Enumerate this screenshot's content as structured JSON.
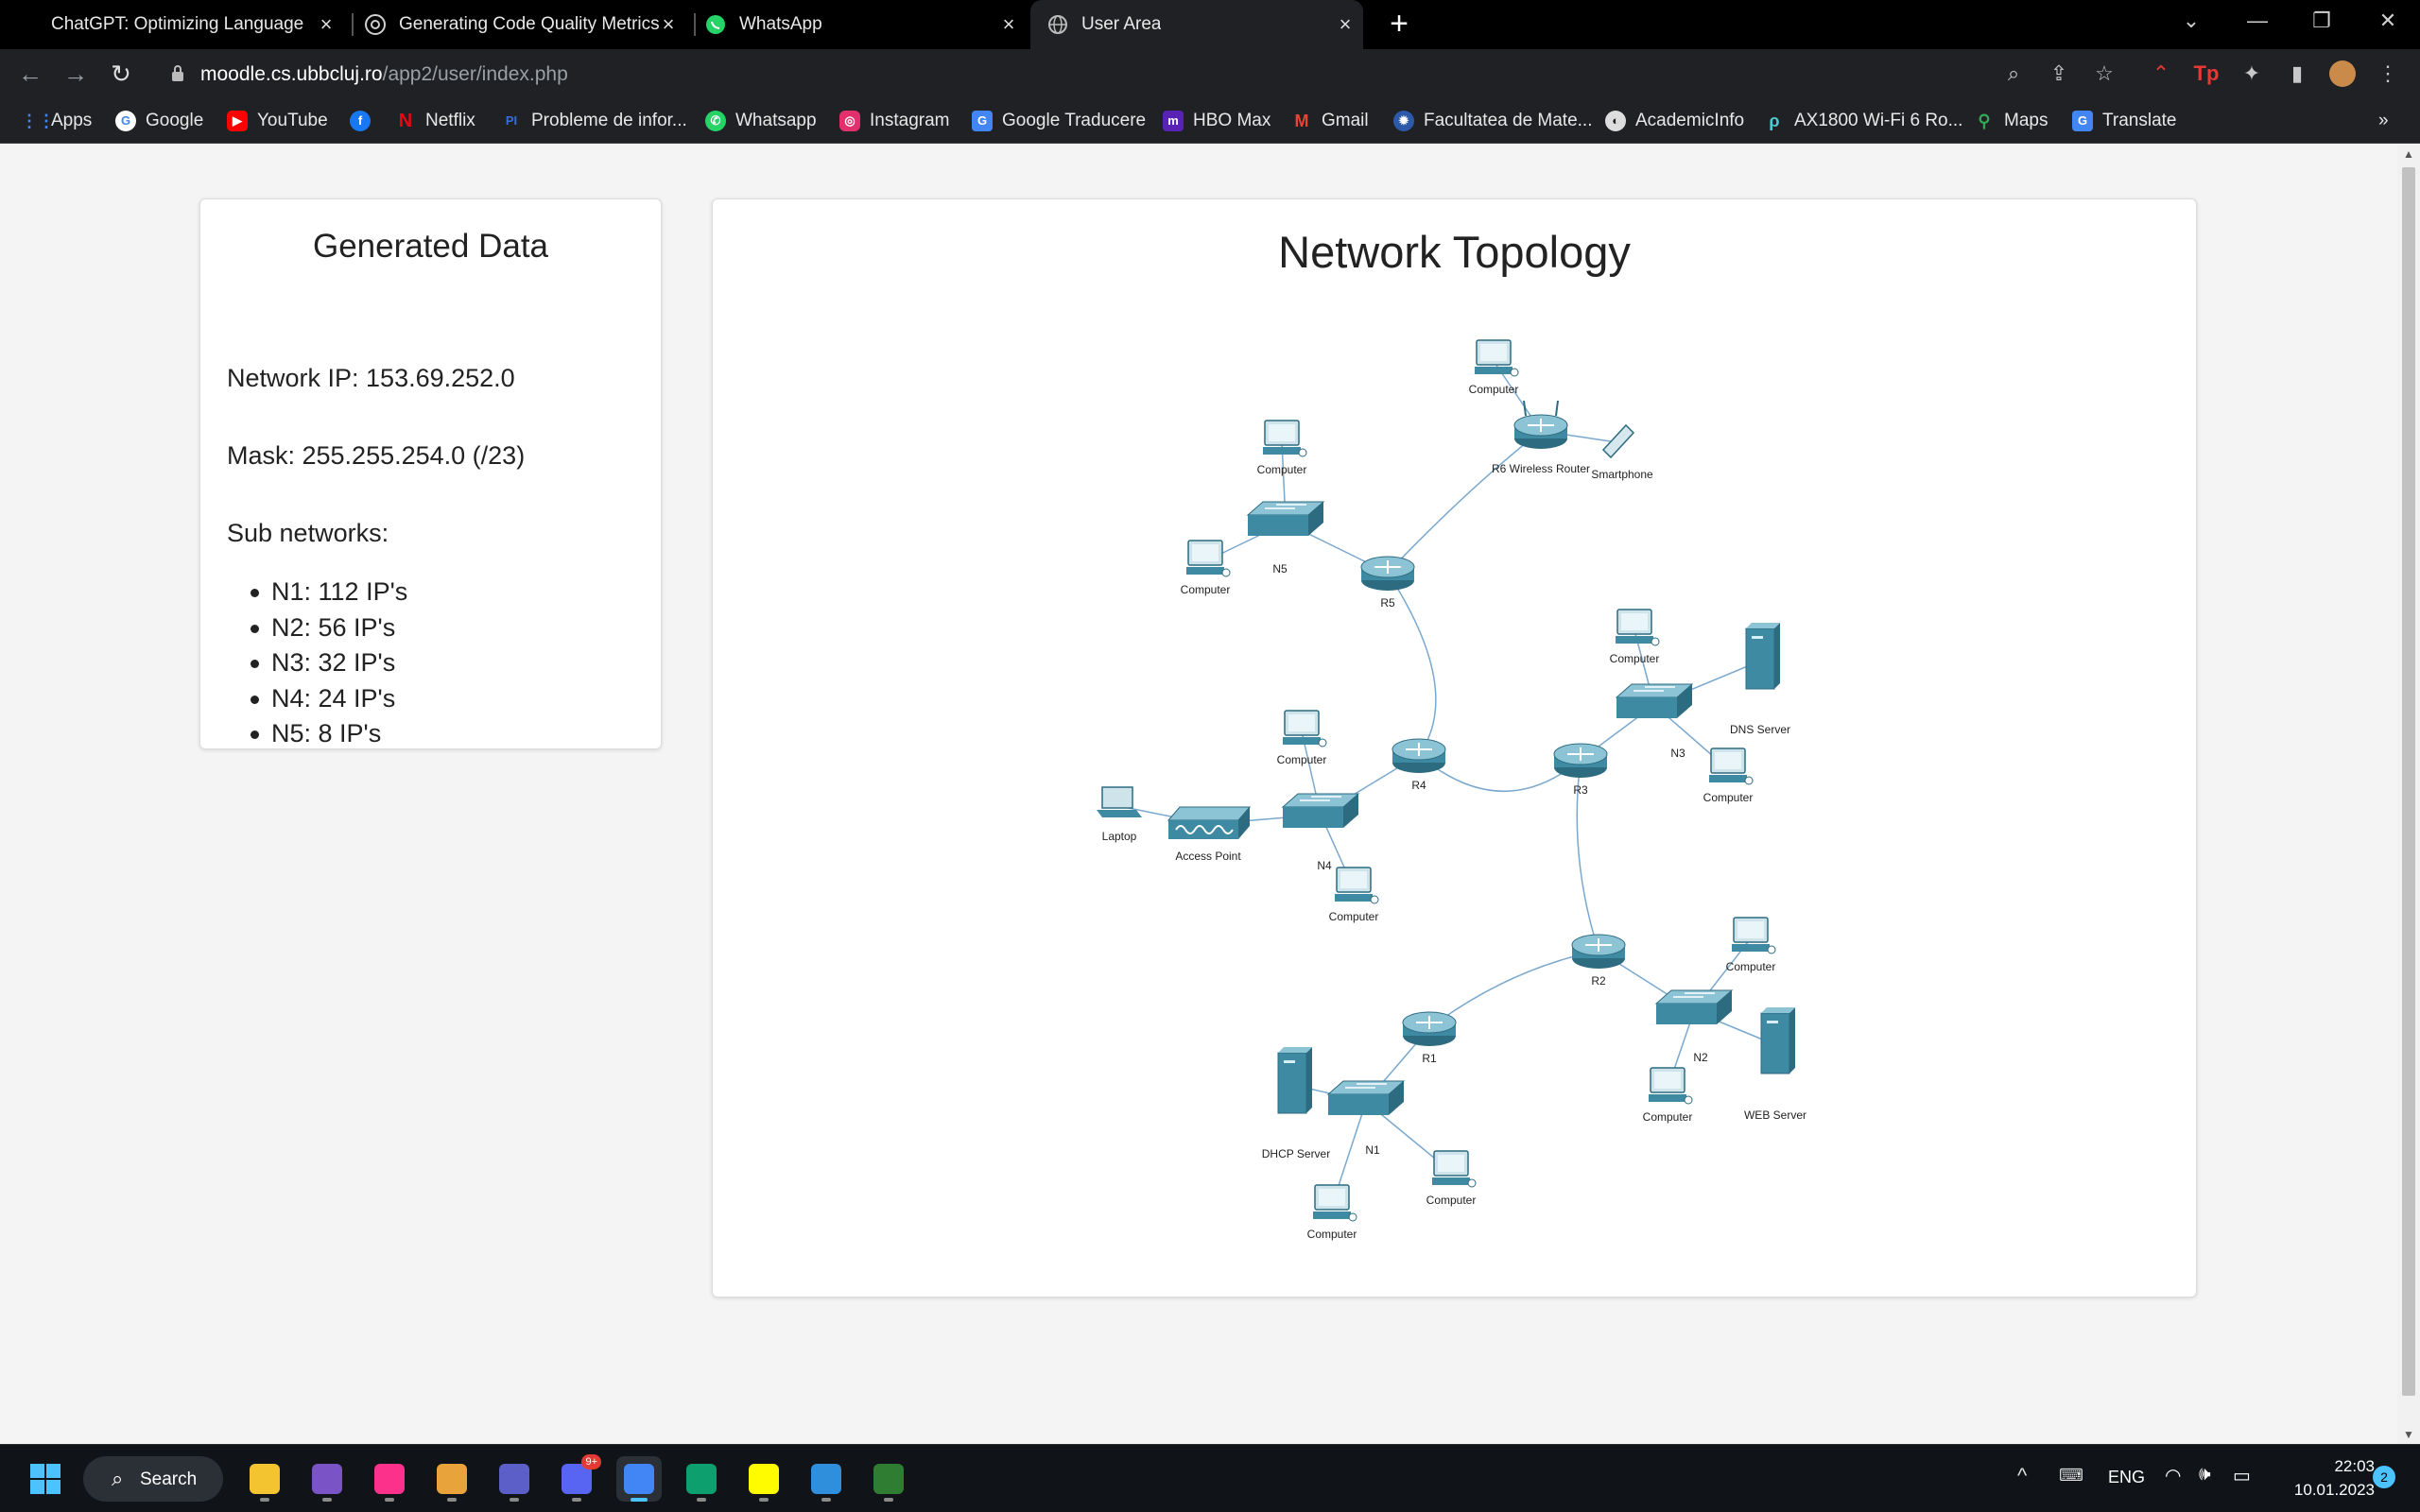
{
  "browser": {
    "tabs": [
      {
        "title": "ChatGPT: Optimizing Language M",
        "favicon": "chatgpt-icon"
      },
      {
        "title": "Generating Code Quality Metrics",
        "favicon": "chatgpt-icon"
      },
      {
        "title": "WhatsApp",
        "favicon": "whatsapp-icon"
      },
      {
        "title": "User Area",
        "favicon": "globe-icon",
        "active": true
      }
    ],
    "url": {
      "host": "moodle.cs.ubbcluj.ro",
      "path": "/app2/user/index.php"
    },
    "bookmarks": [
      {
        "label": "Apps",
        "icon": "apps-grid-icon",
        "color": "#4285f4"
      },
      {
        "label": "Google",
        "icon": "google-icon",
        "color": "#ffffff"
      },
      {
        "label": "YouTube",
        "icon": "youtube-icon",
        "color": "#ff0000"
      },
      {
        "label": "",
        "icon": "facebook-icon",
        "color": "#1877f2"
      },
      {
        "label": "Netflix",
        "icon": "netflix-icon",
        "color": "#e50914"
      },
      {
        "label": "Probleme de infor...",
        "icon": "pbinfo-icon",
        "color": "#3b6fd8"
      },
      {
        "label": "Whatsapp",
        "icon": "whatsapp-icon",
        "color": "#25d366"
      },
      {
        "label": "Instagram",
        "icon": "instagram-icon",
        "color": "#e1306c"
      },
      {
        "label": "Google Traducere",
        "icon": "translate-icon",
        "color": "#4285f4"
      },
      {
        "label": "HBO Max",
        "icon": "hbomax-icon",
        "color": "#5822b4"
      },
      {
        "label": "Gmail",
        "icon": "gmail-icon",
        "color": "#ea4335"
      },
      {
        "label": "Facultatea de Mate...",
        "icon": "university-icon",
        "color": "#2d5aa8"
      },
      {
        "label": "AcademicInfo",
        "icon": "academicinfo-icon",
        "color": "#dddddd"
      },
      {
        "label": "AX1800 Wi-Fi 6 Ro...",
        "icon": "tplink-icon",
        "color": "#4acbd6"
      },
      {
        "label": "Maps",
        "icon": "maps-icon",
        "color": "#34a853"
      },
      {
        "label": "Translate",
        "icon": "translate-icon",
        "color": "#4285f4"
      }
    ],
    "overflow_label": "»"
  },
  "generated": {
    "title": "Generated Data",
    "network_ip": "Network IP: 153.69.252.0",
    "mask": "Mask: 255.255.254.0 (/23)",
    "subnets_heading": "Sub networks:",
    "subnets": [
      "N1: 112 IP's",
      "N2: 56 IP's",
      "N3: 32 IP's",
      "N4: 24 IP's",
      "N5: 8 IP's"
    ]
  },
  "topology": {
    "title": "Network Topology",
    "devices": [
      {
        "id": "pc-r6",
        "type": "computer",
        "label": "Computer"
      },
      {
        "id": "r6",
        "type": "wireless-router",
        "label": "R6  Wireless Router"
      },
      {
        "id": "phone",
        "type": "smartphone",
        "label": "Smartphone"
      },
      {
        "id": "pc-n5a",
        "type": "computer",
        "label": "Computer"
      },
      {
        "id": "n5",
        "type": "switch",
        "label": "N5"
      },
      {
        "id": "pc-n5b",
        "type": "computer",
        "label": "Computer"
      },
      {
        "id": "r5",
        "type": "router",
        "label": "R5"
      },
      {
        "id": "pc-n3a",
        "type": "computer",
        "label": "Computer"
      },
      {
        "id": "dns",
        "type": "server",
        "label": "DNS Server"
      },
      {
        "id": "n3",
        "type": "switch",
        "label": "N3"
      },
      {
        "id": "pc-n3b",
        "type": "computer",
        "label": "Computer"
      },
      {
        "id": "r3",
        "type": "router",
        "label": "R3"
      },
      {
        "id": "r4",
        "type": "router",
        "label": "R4"
      },
      {
        "id": "pc-n4a",
        "type": "computer",
        "label": "Computer"
      },
      {
        "id": "n4",
        "type": "switch",
        "label": "N4"
      },
      {
        "id": "ap",
        "type": "access-point",
        "label": "Access Point"
      },
      {
        "id": "laptop",
        "type": "laptop",
        "label": "Laptop"
      },
      {
        "id": "pc-n4b",
        "type": "computer",
        "label": "Computer"
      },
      {
        "id": "r2",
        "type": "router",
        "label": "R2"
      },
      {
        "id": "pc-n2a",
        "type": "computer",
        "label": "Computer"
      },
      {
        "id": "n2",
        "type": "switch",
        "label": "N2"
      },
      {
        "id": "web",
        "type": "server",
        "label": "WEB Server"
      },
      {
        "id": "pc-n2b",
        "type": "computer",
        "label": "Computer"
      },
      {
        "id": "r1",
        "type": "router",
        "label": "R1"
      },
      {
        "id": "dhcp",
        "type": "server",
        "label": "DHCP Server"
      },
      {
        "id": "n1",
        "type": "switch",
        "label": "N1"
      },
      {
        "id": "pc-n1a",
        "type": "computer",
        "label": "Computer"
      },
      {
        "id": "pc-n1b",
        "type": "computer",
        "label": "Computer"
      }
    ],
    "links": [
      [
        "pc-r6",
        "r6"
      ],
      [
        "r6",
        "phone"
      ],
      [
        "r6",
        "r5"
      ],
      [
        "pc-n5a",
        "n5"
      ],
      [
        "n5",
        "pc-n5b"
      ],
      [
        "n5",
        "r5"
      ],
      [
        "r5",
        "r4"
      ],
      [
        "r4",
        "r3"
      ],
      [
        "r4",
        "n4"
      ],
      [
        "pc-n4a",
        "n4"
      ],
      [
        "n4",
        "ap"
      ],
      [
        "ap",
        "laptop"
      ],
      [
        "n4",
        "pc-n4b"
      ],
      [
        "r3",
        "n3"
      ],
      [
        "pc-n3a",
        "n3"
      ],
      [
        "n3",
        "dns"
      ],
      [
        "n3",
        "pc-n3b"
      ],
      [
        "r3",
        "r2"
      ],
      [
        "r2",
        "n2"
      ],
      [
        "pc-n2a",
        "n2"
      ],
      [
        "n2",
        "web"
      ],
      [
        "n2",
        "pc-n2b"
      ],
      [
        "r2",
        "r1"
      ],
      [
        "r1",
        "n1"
      ],
      [
        "dhcp",
        "n1"
      ],
      [
        "n1",
        "pc-n1a"
      ],
      [
        "n1",
        "pc-n1b"
      ]
    ]
  },
  "taskbar": {
    "search_label": "Search",
    "apps": [
      {
        "name": "file-explorer",
        "color": "#f4c430"
      },
      {
        "name": "visual-studio",
        "color": "#7a53c6"
      },
      {
        "name": "intellij",
        "color": "#fc318c"
      },
      {
        "name": "photos-editor",
        "color": "#e8a33b"
      },
      {
        "name": "teams",
        "color": "#5b5fc7"
      },
      {
        "name": "discord",
        "color": "#5865f2",
        "badge": "9+"
      },
      {
        "name": "chrome",
        "color": "#4285f4"
      },
      {
        "name": "edge",
        "color": "#0e9f6e"
      },
      {
        "name": "snapchat",
        "color": "#fffc00"
      },
      {
        "name": "paint",
        "color": "#2f8fdd"
      },
      {
        "name": "packet-tracer",
        "color": "#2e7d32"
      }
    ],
    "language": "ENG",
    "time": "22:03",
    "date": "10.01.2023",
    "notifications": "2"
  }
}
